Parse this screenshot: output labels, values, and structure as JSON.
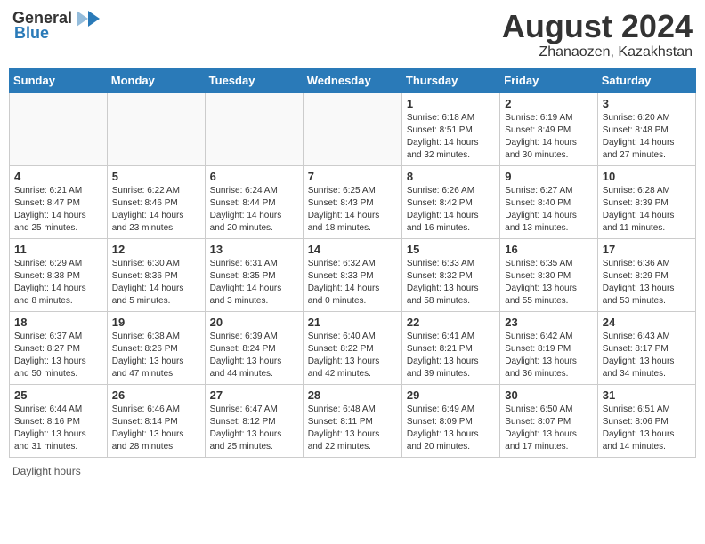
{
  "header": {
    "logo_general": "General",
    "logo_blue": "Blue",
    "month_year": "August 2024",
    "location": "Zhanaozen, Kazakhstan"
  },
  "calendar": {
    "days_of_week": [
      "Sunday",
      "Monday",
      "Tuesday",
      "Wednesday",
      "Thursday",
      "Friday",
      "Saturday"
    ],
    "weeks": [
      [
        {
          "day": "",
          "info": ""
        },
        {
          "day": "",
          "info": ""
        },
        {
          "day": "",
          "info": ""
        },
        {
          "day": "",
          "info": ""
        },
        {
          "day": "1",
          "info": "Sunrise: 6:18 AM\nSunset: 8:51 PM\nDaylight: 14 hours\nand 32 minutes."
        },
        {
          "day": "2",
          "info": "Sunrise: 6:19 AM\nSunset: 8:49 PM\nDaylight: 14 hours\nand 30 minutes."
        },
        {
          "day": "3",
          "info": "Sunrise: 6:20 AM\nSunset: 8:48 PM\nDaylight: 14 hours\nand 27 minutes."
        }
      ],
      [
        {
          "day": "4",
          "info": "Sunrise: 6:21 AM\nSunset: 8:47 PM\nDaylight: 14 hours\nand 25 minutes."
        },
        {
          "day": "5",
          "info": "Sunrise: 6:22 AM\nSunset: 8:46 PM\nDaylight: 14 hours\nand 23 minutes."
        },
        {
          "day": "6",
          "info": "Sunrise: 6:24 AM\nSunset: 8:44 PM\nDaylight: 14 hours\nand 20 minutes."
        },
        {
          "day": "7",
          "info": "Sunrise: 6:25 AM\nSunset: 8:43 PM\nDaylight: 14 hours\nand 18 minutes."
        },
        {
          "day": "8",
          "info": "Sunrise: 6:26 AM\nSunset: 8:42 PM\nDaylight: 14 hours\nand 16 minutes."
        },
        {
          "day": "9",
          "info": "Sunrise: 6:27 AM\nSunset: 8:40 PM\nDaylight: 14 hours\nand 13 minutes."
        },
        {
          "day": "10",
          "info": "Sunrise: 6:28 AM\nSunset: 8:39 PM\nDaylight: 14 hours\nand 11 minutes."
        }
      ],
      [
        {
          "day": "11",
          "info": "Sunrise: 6:29 AM\nSunset: 8:38 PM\nDaylight: 14 hours\nand 8 minutes."
        },
        {
          "day": "12",
          "info": "Sunrise: 6:30 AM\nSunset: 8:36 PM\nDaylight: 14 hours\nand 5 minutes."
        },
        {
          "day": "13",
          "info": "Sunrise: 6:31 AM\nSunset: 8:35 PM\nDaylight: 14 hours\nand 3 minutes."
        },
        {
          "day": "14",
          "info": "Sunrise: 6:32 AM\nSunset: 8:33 PM\nDaylight: 14 hours\nand 0 minutes."
        },
        {
          "day": "15",
          "info": "Sunrise: 6:33 AM\nSunset: 8:32 PM\nDaylight: 13 hours\nand 58 minutes."
        },
        {
          "day": "16",
          "info": "Sunrise: 6:35 AM\nSunset: 8:30 PM\nDaylight: 13 hours\nand 55 minutes."
        },
        {
          "day": "17",
          "info": "Sunrise: 6:36 AM\nSunset: 8:29 PM\nDaylight: 13 hours\nand 53 minutes."
        }
      ],
      [
        {
          "day": "18",
          "info": "Sunrise: 6:37 AM\nSunset: 8:27 PM\nDaylight: 13 hours\nand 50 minutes."
        },
        {
          "day": "19",
          "info": "Sunrise: 6:38 AM\nSunset: 8:26 PM\nDaylight: 13 hours\nand 47 minutes."
        },
        {
          "day": "20",
          "info": "Sunrise: 6:39 AM\nSunset: 8:24 PM\nDaylight: 13 hours\nand 44 minutes."
        },
        {
          "day": "21",
          "info": "Sunrise: 6:40 AM\nSunset: 8:22 PM\nDaylight: 13 hours\nand 42 minutes."
        },
        {
          "day": "22",
          "info": "Sunrise: 6:41 AM\nSunset: 8:21 PM\nDaylight: 13 hours\nand 39 minutes."
        },
        {
          "day": "23",
          "info": "Sunrise: 6:42 AM\nSunset: 8:19 PM\nDaylight: 13 hours\nand 36 minutes."
        },
        {
          "day": "24",
          "info": "Sunrise: 6:43 AM\nSunset: 8:17 PM\nDaylight: 13 hours\nand 34 minutes."
        }
      ],
      [
        {
          "day": "25",
          "info": "Sunrise: 6:44 AM\nSunset: 8:16 PM\nDaylight: 13 hours\nand 31 minutes."
        },
        {
          "day": "26",
          "info": "Sunrise: 6:46 AM\nSunset: 8:14 PM\nDaylight: 13 hours\nand 28 minutes."
        },
        {
          "day": "27",
          "info": "Sunrise: 6:47 AM\nSunset: 8:12 PM\nDaylight: 13 hours\nand 25 minutes."
        },
        {
          "day": "28",
          "info": "Sunrise: 6:48 AM\nSunset: 8:11 PM\nDaylight: 13 hours\nand 22 minutes."
        },
        {
          "day": "29",
          "info": "Sunrise: 6:49 AM\nSunset: 8:09 PM\nDaylight: 13 hours\nand 20 minutes."
        },
        {
          "day": "30",
          "info": "Sunrise: 6:50 AM\nSunset: 8:07 PM\nDaylight: 13 hours\nand 17 minutes."
        },
        {
          "day": "31",
          "info": "Sunrise: 6:51 AM\nSunset: 8:06 PM\nDaylight: 13 hours\nand 14 minutes."
        }
      ]
    ]
  },
  "footer": {
    "daylight_hours": "Daylight hours"
  }
}
